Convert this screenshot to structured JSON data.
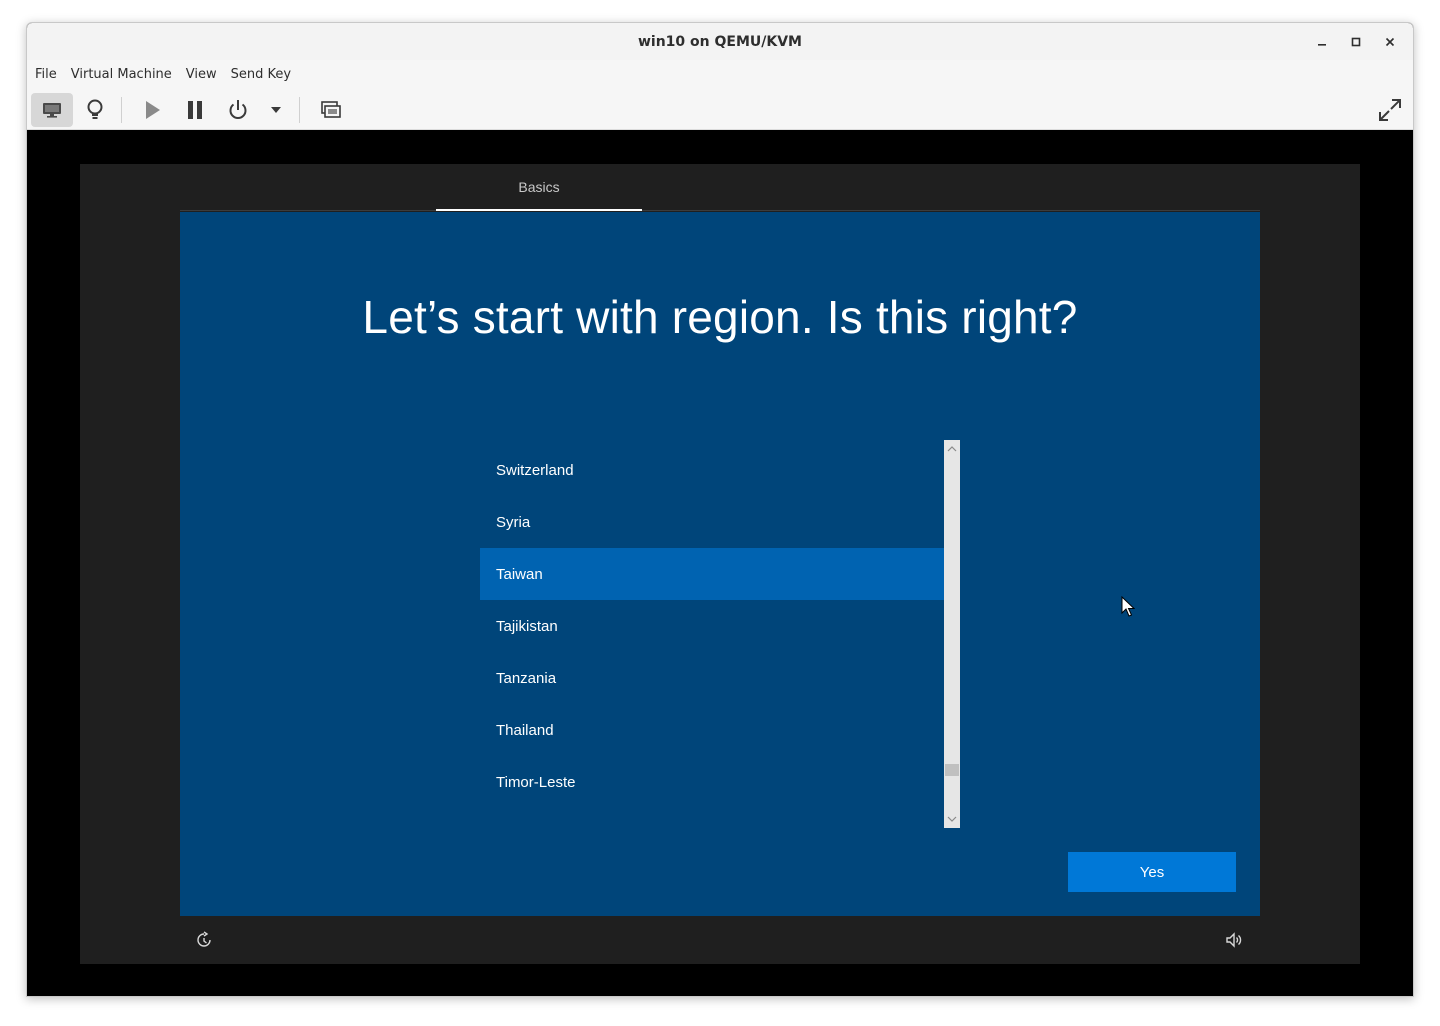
{
  "window": {
    "title": "win10 on QEMU/KVM",
    "controls": [
      "minimize-icon",
      "maximize-icon",
      "close-icon"
    ]
  },
  "menubar": {
    "items": [
      "File",
      "Virtual Machine",
      "View",
      "Send Key"
    ]
  },
  "toolbar": {
    "buttons": [
      "monitor-icon",
      "lightbulb-icon",
      "play-icon",
      "pause-icon",
      "power-icon",
      "dropdown-arrow-icon",
      "snapshot-icon",
      "fullscreen-icon"
    ]
  },
  "setup": {
    "tab_label": "Basics",
    "heading": "Let’s start with region. Is this right?",
    "regions": [
      "Switzerland",
      "Syria",
      "Taiwan",
      "Tajikistan",
      "Tanzania",
      "Thailand",
      "Timor-Leste"
    ],
    "selected_region": "Taiwan",
    "yes_label": "Yes"
  },
  "colors": {
    "panel_bg": "#00457a",
    "selected_bg": "#0063b1",
    "button_bg": "#0078d7",
    "outer_bg": "#1f1f1f"
  }
}
